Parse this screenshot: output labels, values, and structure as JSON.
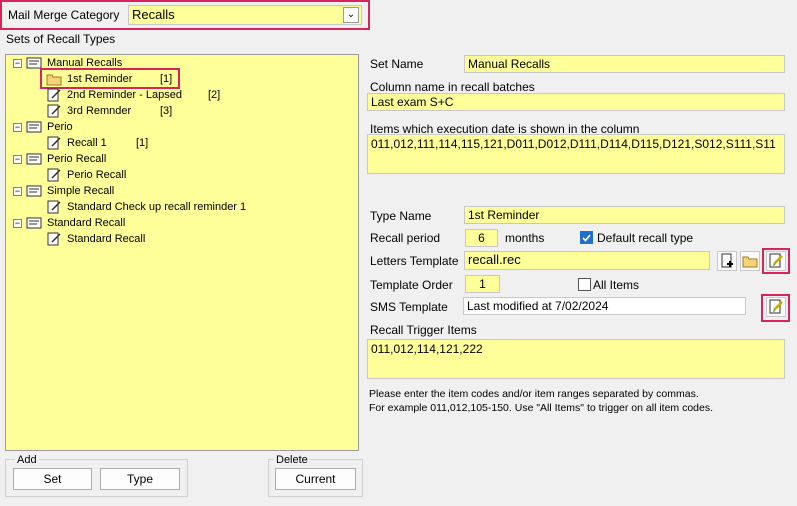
{
  "category": {
    "label": "Mail Merge Category",
    "value": "Recalls"
  },
  "sets_title": "Sets of Recall Types",
  "tree": [
    {
      "label": "Manual Recalls",
      "count": ""
    },
    {
      "label": "1st Reminder",
      "count": "[1]"
    },
    {
      "label": "2nd Reminder - Lapsed",
      "count": "[2]"
    },
    {
      "label": "3rd Remnder",
      "count": "[3]"
    },
    {
      "label": "Perio",
      "count": ""
    },
    {
      "label": "Recall 1",
      "count": "[1]"
    },
    {
      "label": "Perio Recall",
      "count": ""
    },
    {
      "label": "Perio Recall",
      "count": ""
    },
    {
      "label": "Simple Recall",
      "count": ""
    },
    {
      "label": "Standard Check up recall reminder 1",
      "count": ""
    },
    {
      "label": "Standard Recall",
      "count": ""
    },
    {
      "label": "Standard Recall",
      "count": ""
    }
  ],
  "add_group": {
    "title": "Add",
    "set": "Set",
    "type": "Type"
  },
  "delete_group": {
    "title": "Delete",
    "current": "Current"
  },
  "form": {
    "set_name_label": "Set Name",
    "set_name": "Manual Recalls",
    "column_name_label": "Column name in recall batches",
    "column_name": "Last exam S+C",
    "items_label": "Items which execution date is shown in the column",
    "items": "011,012,111,114,115,121,D011,D012,D111,D114,D115,D121,S012,S111,S11",
    "type_name_label": "Type Name",
    "type_name": "1st Reminder",
    "recall_period_label": "Recall period",
    "recall_period": "6",
    "months_label": "months",
    "default_recall_label": "Default recall type",
    "letters_template_label": "Letters Template",
    "letters_template": "recall.rec",
    "template_order_label": "Template Order",
    "template_order": "1",
    "all_items_label": "All Items",
    "sms_template_label": "SMS Template",
    "sms_template": "Last modified at 7/02/2024",
    "trigger_label": "Recall Trigger Items",
    "trigger_items": "011,012,114,121,222",
    "help_line1": "Please enter the item codes and/or item ranges separated by commas.",
    "help_line2": "For example 011,012,105-150. Use \"All Items\" to trigger on all item codes."
  },
  "colors": {
    "highlight": "#d6245c",
    "field": "#ffff99",
    "check": "#1e6fd0"
  }
}
